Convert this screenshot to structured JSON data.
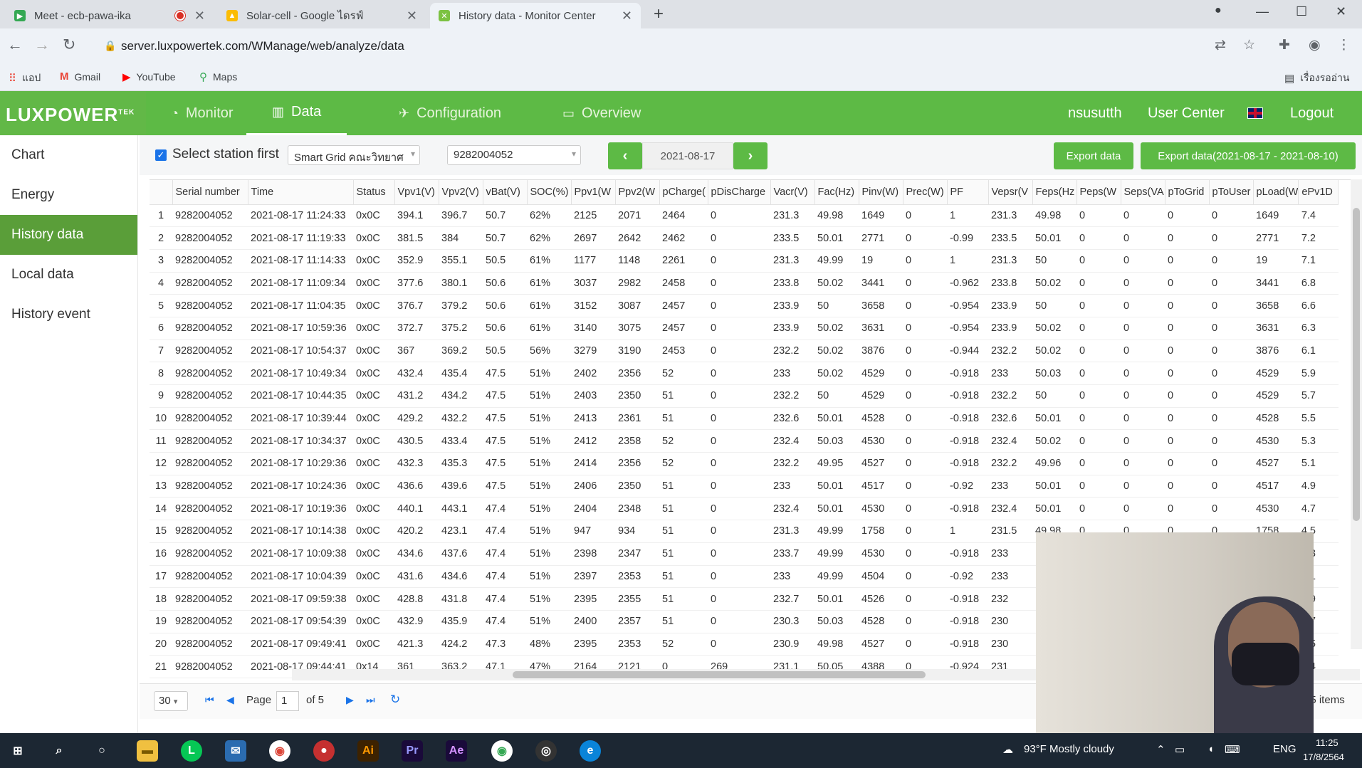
{
  "browser": {
    "tabs": [
      {
        "title": "Meet - ecb-pawa-ika",
        "icon": "meet-icon"
      },
      {
        "title": "Solar-cell - Google ไดรฟ์",
        "icon": "google-drive-icon"
      },
      {
        "title": "History data - Monitor Center",
        "icon": "luxpower-icon"
      }
    ],
    "url": "server.luxpowertek.com/WManage/web/analyze/data",
    "bookmarks": [
      {
        "label": "แอป",
        "icon": "apps-grid-icon"
      },
      {
        "label": "Gmail",
        "icon": "gmail-icon"
      },
      {
        "label": "YouTube",
        "icon": "youtube-icon"
      },
      {
        "label": "Maps",
        "icon": "maps-icon"
      }
    ],
    "reading_list": "เรื่องรออ่าน"
  },
  "header": {
    "logo": "LUXPOWER",
    "logo_sup": "TEK",
    "menu": [
      {
        "label": "Monitor",
        "icon": "gauge-icon"
      },
      {
        "label": "Data",
        "icon": "chart-icon"
      },
      {
        "label": "Configuration",
        "icon": "rocket-icon"
      },
      {
        "label": "Overview",
        "icon": "book-icon"
      }
    ],
    "user": "nsusutth",
    "user_center": "User Center",
    "logout": "Logout"
  },
  "sidebar": {
    "items": [
      "Chart",
      "Energy",
      "History data",
      "Local data",
      "History event"
    ]
  },
  "filters": {
    "select_station_label": "Select station first",
    "station": "Smart Grid คณะวิทยาศ",
    "serial": "9282004052",
    "date": "2021-08-17",
    "export_label": "Export data",
    "export_range_label": "Export data(2021-08-17 - 2021-08-10)"
  },
  "table": {
    "columns": [
      "",
      "Serial number",
      "Time",
      "Status",
      "Vpv1(V)",
      "Vpv2(V)",
      "vBat(V)",
      "SOC(%)",
      "Ppv1(W",
      "Ppv2(W",
      "pCharge(",
      "pDisCharge",
      "Vacr(V)",
      "Fac(Hz)",
      "Pinv(W)",
      "Prec(W)",
      "PF",
      "Vepsr(V",
      "Feps(Hz",
      "Peps(W",
      "Seps(VA",
      "pToGrid",
      "pToUser",
      "pLoad(W",
      "ePv1D"
    ],
    "rows": [
      [
        "1",
        "9282004052",
        "2021-08-17 11:24:33",
        "0x0C",
        "394.1",
        "396.7",
        "50.7",
        "62%",
        "2125",
        "2071",
        "2464",
        "0",
        "231.3",
        "49.98",
        "1649",
        "0",
        "1",
        "231.3",
        "49.98",
        "0",
        "0",
        "0",
        "0",
        "1649",
        "7.4"
      ],
      [
        "2",
        "9282004052",
        "2021-08-17 11:19:33",
        "0x0C",
        "381.5",
        "384",
        "50.7",
        "62%",
        "2697",
        "2642",
        "2462",
        "0",
        "233.5",
        "50.01",
        "2771",
        "0",
        "-0.99",
        "233.5",
        "50.01",
        "0",
        "0",
        "0",
        "0",
        "2771",
        "7.2"
      ],
      [
        "3",
        "9282004052",
        "2021-08-17 11:14:33",
        "0x0C",
        "352.9",
        "355.1",
        "50.5",
        "61%",
        "1177",
        "1148",
        "2261",
        "0",
        "231.3",
        "49.99",
        "19",
        "0",
        "1",
        "231.3",
        "50",
        "0",
        "0",
        "0",
        "0",
        "19",
        "7.1"
      ],
      [
        "4",
        "9282004052",
        "2021-08-17 11:09:34",
        "0x0C",
        "377.6",
        "380.1",
        "50.6",
        "61%",
        "3037",
        "2982",
        "2458",
        "0",
        "233.8",
        "50.02",
        "3441",
        "0",
        "-0.962",
        "233.8",
        "50.02",
        "0",
        "0",
        "0",
        "0",
        "3441",
        "6.8"
      ],
      [
        "5",
        "9282004052",
        "2021-08-17 11:04:35",
        "0x0C",
        "376.7",
        "379.2",
        "50.6",
        "61%",
        "3152",
        "3087",
        "2457",
        "0",
        "233.9",
        "50",
        "3658",
        "0",
        "-0.954",
        "233.9",
        "50",
        "0",
        "0",
        "0",
        "0",
        "3658",
        "6.6"
      ],
      [
        "6",
        "9282004052",
        "2021-08-17 10:59:36",
        "0x0C",
        "372.7",
        "375.2",
        "50.6",
        "61%",
        "3140",
        "3075",
        "2457",
        "0",
        "233.9",
        "50.02",
        "3631",
        "0",
        "-0.954",
        "233.9",
        "50.02",
        "0",
        "0",
        "0",
        "0",
        "3631",
        "6.3"
      ],
      [
        "7",
        "9282004052",
        "2021-08-17 10:54:37",
        "0x0C",
        "367",
        "369.2",
        "50.5",
        "56%",
        "3279",
        "3190",
        "2453",
        "0",
        "232.2",
        "50.02",
        "3876",
        "0",
        "-0.944",
        "232.2",
        "50.02",
        "0",
        "0",
        "0",
        "0",
        "3876",
        "6.1"
      ],
      [
        "8",
        "9282004052",
        "2021-08-17 10:49:34",
        "0x0C",
        "432.4",
        "435.4",
        "47.5",
        "51%",
        "2402",
        "2356",
        "52",
        "0",
        "233",
        "50.02",
        "4529",
        "0",
        "-0.918",
        "233",
        "50.03",
        "0",
        "0",
        "0",
        "0",
        "4529",
        "5.9"
      ],
      [
        "9",
        "9282004052",
        "2021-08-17 10:44:35",
        "0x0C",
        "431.2",
        "434.2",
        "47.5",
        "51%",
        "2403",
        "2350",
        "51",
        "0",
        "232.2",
        "50",
        "4529",
        "0",
        "-0.918",
        "232.2",
        "50",
        "0",
        "0",
        "0",
        "0",
        "4529",
        "5.7"
      ],
      [
        "10",
        "9282004052",
        "2021-08-17 10:39:44",
        "0x0C",
        "429.2",
        "432.2",
        "47.5",
        "51%",
        "2413",
        "2361",
        "51",
        "0",
        "232.6",
        "50.01",
        "4528",
        "0",
        "-0.918",
        "232.6",
        "50.01",
        "0",
        "0",
        "0",
        "0",
        "4528",
        "5.5"
      ],
      [
        "11",
        "9282004052",
        "2021-08-17 10:34:37",
        "0x0C",
        "430.5",
        "433.4",
        "47.5",
        "51%",
        "2412",
        "2358",
        "52",
        "0",
        "232.4",
        "50.03",
        "4530",
        "0",
        "-0.918",
        "232.4",
        "50.02",
        "0",
        "0",
        "0",
        "0",
        "4530",
        "5.3"
      ],
      [
        "12",
        "9282004052",
        "2021-08-17 10:29:36",
        "0x0C",
        "432.3",
        "435.3",
        "47.5",
        "51%",
        "2414",
        "2356",
        "52",
        "0",
        "232.2",
        "49.95",
        "4527",
        "0",
        "-0.918",
        "232.2",
        "49.96",
        "0",
        "0",
        "0",
        "0",
        "4527",
        "5.1"
      ],
      [
        "13",
        "9282004052",
        "2021-08-17 10:24:36",
        "0x0C",
        "436.6",
        "439.6",
        "47.5",
        "51%",
        "2406",
        "2350",
        "51",
        "0",
        "233",
        "50.01",
        "4517",
        "0",
        "-0.92",
        "233",
        "50.01",
        "0",
        "0",
        "0",
        "0",
        "4517",
        "4.9"
      ],
      [
        "14",
        "9282004052",
        "2021-08-17 10:19:36",
        "0x0C",
        "440.1",
        "443.1",
        "47.4",
        "51%",
        "2404",
        "2348",
        "51",
        "0",
        "232.4",
        "50.01",
        "4530",
        "0",
        "-0.918",
        "232.4",
        "50.01",
        "0",
        "0",
        "0",
        "0",
        "4530",
        "4.7"
      ],
      [
        "15",
        "9282004052",
        "2021-08-17 10:14:38",
        "0x0C",
        "420.2",
        "423.1",
        "47.4",
        "51%",
        "947",
        "934",
        "51",
        "0",
        "231.3",
        "49.99",
        "1758",
        "0",
        "1",
        "231.5",
        "49.98",
        "0",
        "0",
        "0",
        "0",
        "1758",
        "4.5"
      ],
      [
        "16",
        "9282004052",
        "2021-08-17 10:09:38",
        "0x0C",
        "434.6",
        "437.6",
        "47.4",
        "51%",
        "2398",
        "2347",
        "51",
        "0",
        "233.7",
        "49.99",
        "4530",
        "0",
        "-0.918",
        "233",
        "",
        "",
        "",
        "",
        "",
        "",
        "4.3"
      ],
      [
        "17",
        "9282004052",
        "2021-08-17 10:04:39",
        "0x0C",
        "431.6",
        "434.6",
        "47.4",
        "51%",
        "2397",
        "2353",
        "51",
        "0",
        "233",
        "49.99",
        "4504",
        "0",
        "-0.92",
        "233",
        "",
        "",
        "",
        "",
        "",
        "",
        "4.1"
      ],
      [
        "18",
        "9282004052",
        "2021-08-17 09:59:38",
        "0x0C",
        "428.8",
        "431.8",
        "47.4",
        "51%",
        "2395",
        "2355",
        "51",
        "0",
        "232.7",
        "50.01",
        "4526",
        "0",
        "-0.918",
        "232",
        "",
        "",
        "",
        "",
        "",
        "",
        "3.9"
      ],
      [
        "19",
        "9282004052",
        "2021-08-17 09:54:39",
        "0x0C",
        "432.9",
        "435.9",
        "47.4",
        "51%",
        "2400",
        "2357",
        "51",
        "0",
        "230.3",
        "50.03",
        "4528",
        "0",
        "-0.918",
        "230",
        "",
        "",
        "",
        "",
        "",
        "",
        "3.7"
      ],
      [
        "20",
        "9282004052",
        "2021-08-17 09:49:41",
        "0x0C",
        "421.3",
        "424.2",
        "47.3",
        "48%",
        "2395",
        "2353",
        "52",
        "0",
        "230.9",
        "49.98",
        "4527",
        "0",
        "-0.918",
        "230",
        "",
        "",
        "",
        "",
        "",
        "",
        "3.5"
      ],
      [
        "21",
        "9282004052",
        "2021-08-17 09:44:41",
        "0x14",
        "361",
        "363.2",
        "47.1",
        "47%",
        "2164",
        "2121",
        "0",
        "269",
        "231.1",
        "50.05",
        "4388",
        "0",
        "-0.924",
        "231",
        "",
        "",
        "",
        "",
        "",
        "",
        "3.4"
      ]
    ]
  },
  "pager": {
    "page_size": "30",
    "page_label": "Page",
    "page": "1",
    "of_label": "of 5",
    "items_label": "35 items"
  },
  "taskbar": {
    "weather": "93°F  Mostly cloudy",
    "lang": "ENG",
    "time": "11:25",
    "date": "17/8/2564"
  }
}
